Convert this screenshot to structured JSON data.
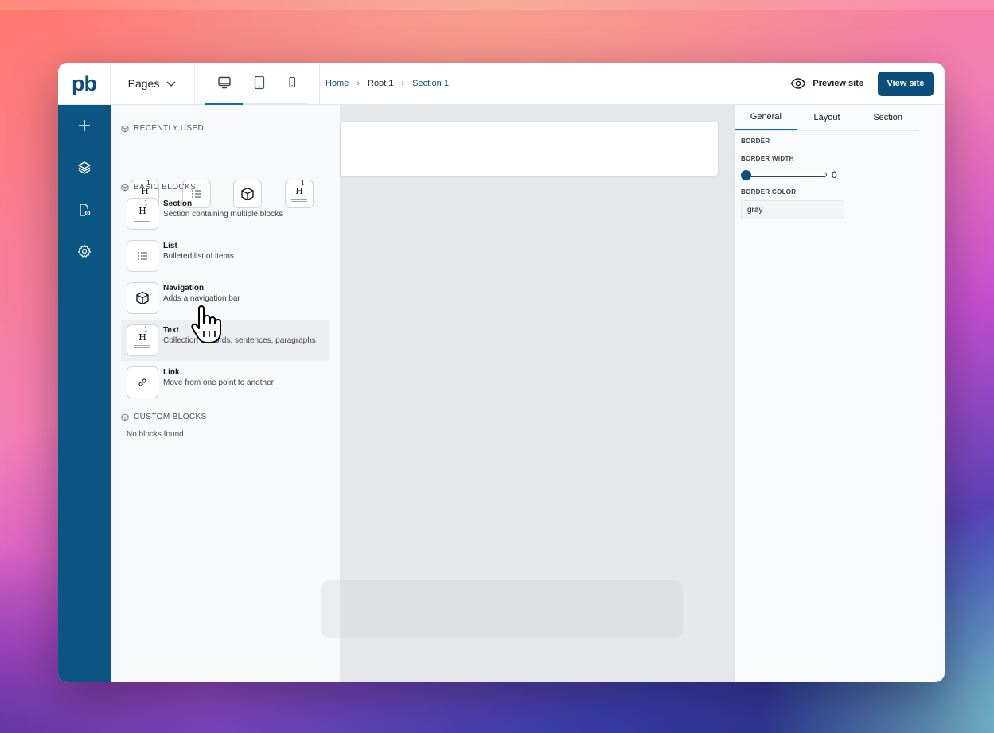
{
  "header": {
    "logo": "pb",
    "pages_label": "Pages",
    "breadcrumb": [
      "Home",
      "Root 1",
      "Section 1"
    ],
    "preview_label": "Preview site",
    "view_site_label": "View site"
  },
  "rail": {
    "items": [
      {
        "icon": "plus-icon"
      },
      {
        "icon": "layers-icon"
      },
      {
        "icon": "page-settings-icon"
      },
      {
        "icon": "gear-icon"
      }
    ]
  },
  "blocks_panel": {
    "recently_used_label": "RECENTLY USED",
    "recently_used": [
      {
        "icon": "heading-icon"
      },
      {
        "icon": "list-icon"
      },
      {
        "icon": "cube-icon"
      },
      {
        "icon": "heading-icon"
      }
    ],
    "basic_blocks_label": "BASIC BLOCKS",
    "basic_blocks": [
      {
        "title": "Section",
        "description": "Section containing multiple blocks",
        "icon": "heading-icon"
      },
      {
        "title": "List",
        "description": "Bulleted list of items",
        "icon": "list-icon"
      },
      {
        "title": "Navigation",
        "description": "Adds a navigation bar",
        "icon": "cube-icon"
      },
      {
        "title": "Text",
        "description": "Collection of words, sentences, paragraphs",
        "icon": "heading-icon"
      },
      {
        "title": "Link",
        "description": "Move from one point to another",
        "icon": "link-icon"
      }
    ],
    "custom_blocks_label": "CUSTOM BLOCKS",
    "custom_blocks_empty": "No blocks found"
  },
  "settings": {
    "tabs": [
      "General",
      "Layout",
      "Section"
    ],
    "active_tab": "General",
    "border_label": "BORDER",
    "border_width_label": "BORDER WIDTH",
    "border_width_value": "0",
    "border_color_label": "BORDER COLOR",
    "border_color_value": "gray"
  },
  "colors": {
    "brand": "#0b4f7c",
    "rail": "#0b5582",
    "accent": "#0d6ea8"
  }
}
